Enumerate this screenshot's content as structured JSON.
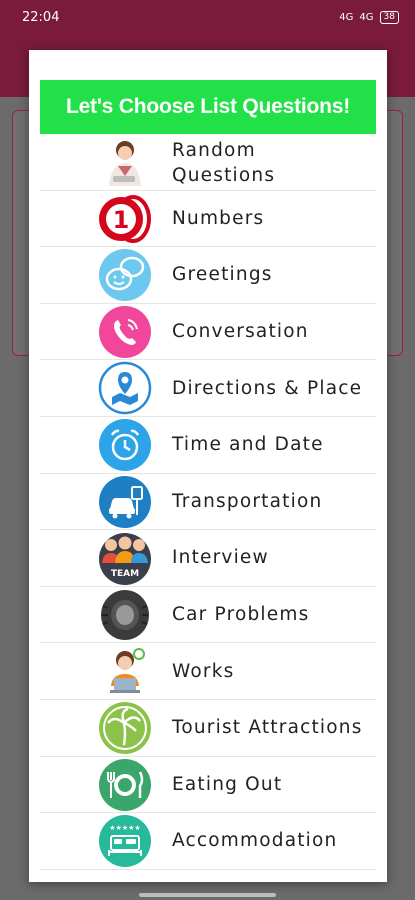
{
  "status": {
    "time": "22:04",
    "signal1": "4G",
    "signal2": "4G",
    "battery": "38"
  },
  "dialog": {
    "title": "Let's Choose List Questions!",
    "items": [
      {
        "label_line1": "Random",
        "label_line2": "Questions",
        "icon": "woman-avatar-icon"
      },
      {
        "label": "Numbers",
        "icon": "number-one-icon"
      },
      {
        "label": "Greetings",
        "icon": "chat-bubbles-icon"
      },
      {
        "label": "Conversation",
        "icon": "phone-icon"
      },
      {
        "label": "Directions & Place",
        "icon": "map-pin-icon"
      },
      {
        "label": "Time and Date",
        "icon": "alarm-clock-icon"
      },
      {
        "label": "Transportation",
        "icon": "car-parking-icon"
      },
      {
        "label": "Interview",
        "icon": "team-icon",
        "icon_text": "TEAM"
      },
      {
        "label": "Car Problems",
        "icon": "tire-icon"
      },
      {
        "label": "Works",
        "icon": "worker-laptop-icon"
      },
      {
        "label": "Tourist Attractions",
        "icon": "palm-icon"
      },
      {
        "label": "Eating Out",
        "icon": "plate-cutlery-icon"
      },
      {
        "label": "Accommodation",
        "icon": "bed-icon"
      }
    ]
  },
  "colors": {
    "appbar": "#7a1b3c",
    "banner": "#22e047"
  }
}
